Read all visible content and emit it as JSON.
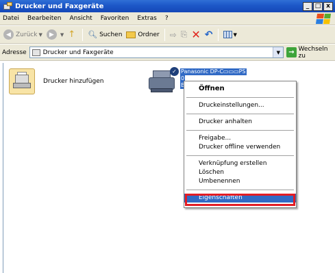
{
  "window": {
    "title": "Drucker und Faxgeräte"
  },
  "window_buttons": {
    "minimize": "_",
    "maximize": "□",
    "close": "x"
  },
  "menu": [
    {
      "text": "Datei"
    },
    {
      "text": "Bearbeiten"
    },
    {
      "text": "Ansicht"
    },
    {
      "text": "Favoriten"
    },
    {
      "text": "Extras"
    },
    {
      "text": "?"
    }
  ],
  "toolbar": {
    "back": "Zurück",
    "search": "Suchen",
    "folders": "Ordner"
  },
  "address": {
    "label": "Adresse",
    "value": "Drucker und Faxgeräte",
    "go": "Wechseln zu"
  },
  "items": {
    "add_printer": "Drucker hinzufügen",
    "printer_lines": [
      "Panasonic DP-C▭▭▭PS",
      "0",
      "Ber"
    ]
  },
  "context_menu": {
    "open": "Öffnen",
    "group1": [
      "Druckeinstellungen..."
    ],
    "group2": [
      "Drucker anhalten"
    ],
    "group3": [
      "Freigabe...",
      "Drucker offline verwenden"
    ],
    "group4": [
      "Verknüpfung erstellen",
      "Löschen",
      "Umbenennen"
    ],
    "properties": "Eigenschaften"
  },
  "colors": {
    "titlebar": "#1c57c7",
    "selection": "#316ac5",
    "highlight_frame": "#e31c24",
    "chrome": "#ece9d8"
  },
  "icons": {
    "back": "back-arrow-icon",
    "forward": "forward-arrow-icon",
    "up": "folder-up-icon",
    "search": "search-icon",
    "folders": "folders-icon",
    "delete": "delete-icon",
    "undo": "undo-icon",
    "views": "views-icon",
    "go": "go-arrow-icon"
  }
}
